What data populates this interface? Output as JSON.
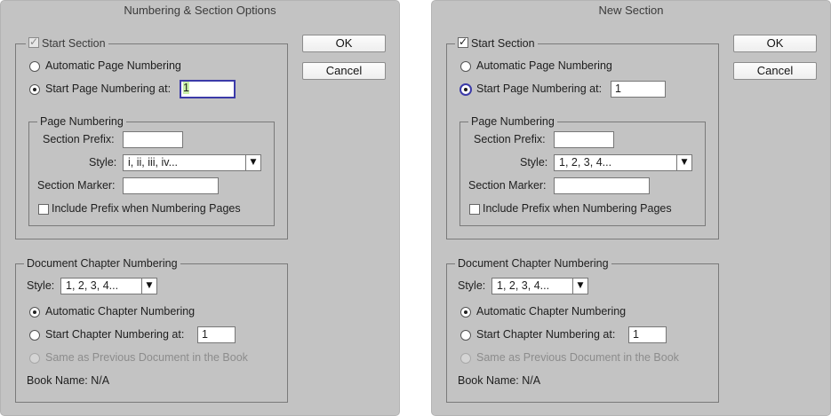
{
  "left": {
    "title": "Numbering & Section Options",
    "ok": "OK",
    "cancel": "Cancel",
    "start_section": "Start Section",
    "auto_page": "Automatic Page Numbering",
    "start_page_at": "Start Page Numbering at:",
    "start_page_value": "1",
    "page_numbering": "Page Numbering",
    "section_prefix": "Section Prefix:",
    "style_label": "Style:",
    "style_value": "i, ii, iii, iv...",
    "section_marker": "Section Marker:",
    "include_prefix": "Include Prefix when Numbering Pages",
    "doc_chapter": "Document Chapter Numbering",
    "chapter_style_label": "Style:",
    "chapter_style_value": "1, 2, 3, 4...",
    "auto_chapter": "Automatic Chapter Numbering",
    "start_chapter_at": "Start Chapter Numbering at:",
    "start_chapter_value": "1",
    "same_as_prev": "Same as Previous Document in the Book",
    "book_name": "Book Name: N/A"
  },
  "right": {
    "title": "New Section",
    "ok": "OK",
    "cancel": "Cancel",
    "start_section": "Start Section",
    "auto_page": "Automatic Page Numbering",
    "start_page_at": "Start Page Numbering at:",
    "start_page_value": "1",
    "page_numbering": "Page Numbering",
    "section_prefix": "Section Prefix:",
    "style_label": "Style:",
    "style_value": "1, 2, 3, 4...",
    "section_marker": "Section Marker:",
    "include_prefix": "Include Prefix when Numbering Pages",
    "doc_chapter": "Document Chapter Numbering",
    "chapter_style_label": "Style:",
    "chapter_style_value": "1, 2, 3, 4...",
    "auto_chapter": "Automatic Chapter Numbering",
    "start_chapter_at": "Start Chapter Numbering at:",
    "start_chapter_value": "1",
    "same_as_prev": "Same as Previous Document in the Book",
    "book_name": "Book Name: N/A"
  },
  "icons": {
    "check": "checkmark-icon",
    "caret": "chevron-down-icon"
  },
  "colors": {
    "dialog_bg": "#c3c3c3",
    "focus_ring": "#3b3aa8",
    "selection": "#c9f0a7"
  }
}
